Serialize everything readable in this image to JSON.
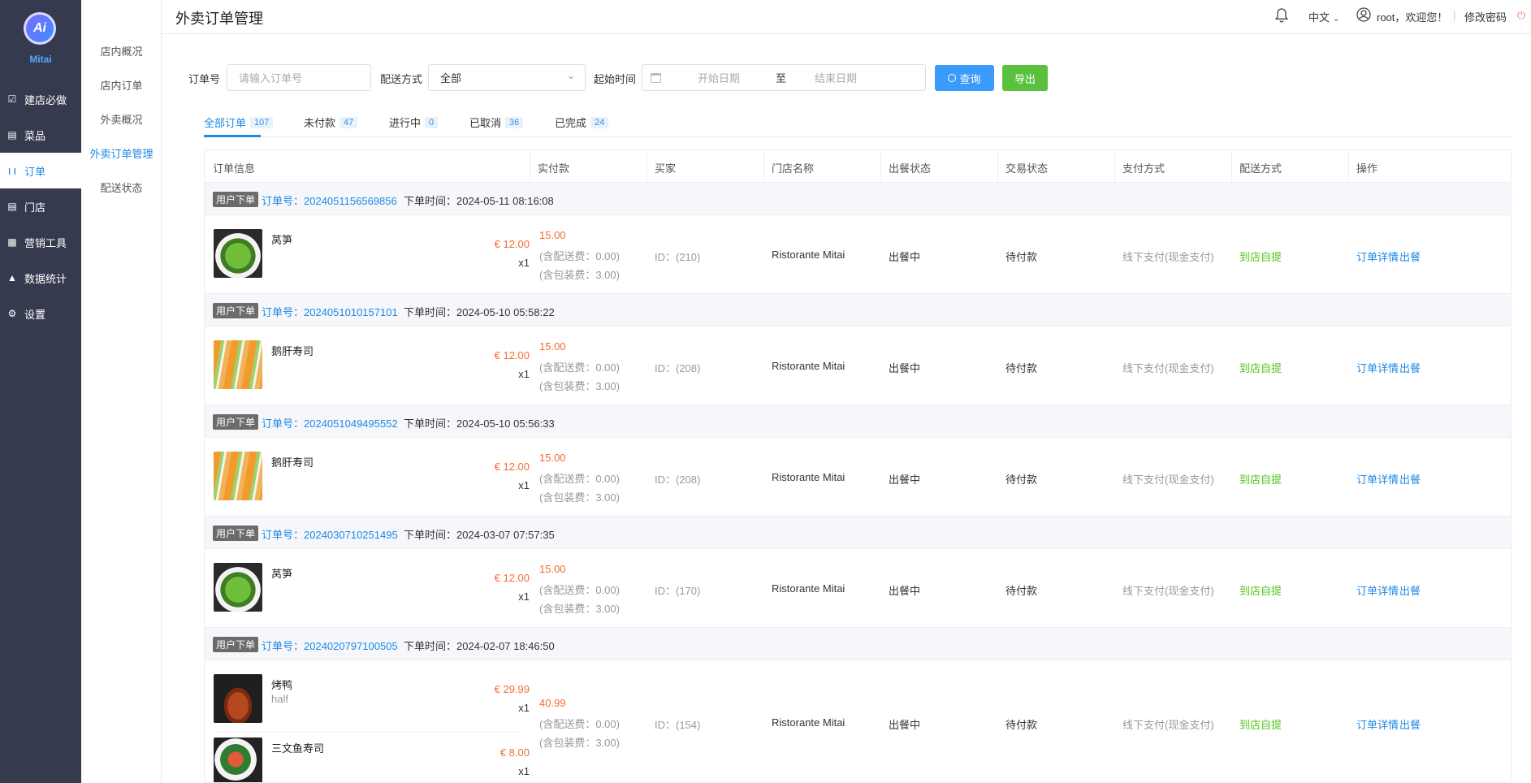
{
  "sidebar": {
    "brand": "Mitai",
    "items": [
      {
        "label": "建店必做",
        "icon": "checkbox-icon"
      },
      {
        "label": "菜品",
        "icon": "dish-icon"
      },
      {
        "label": "订单",
        "icon": "fork-knife-icon",
        "active": true
      },
      {
        "label": "门店",
        "icon": "store-icon"
      },
      {
        "label": "营销工具",
        "icon": "basket-icon"
      },
      {
        "label": "数据统计",
        "icon": "chart-icon"
      },
      {
        "label": "设置",
        "icon": "gear-icon"
      }
    ]
  },
  "submenu": {
    "items": [
      {
        "label": "店内概况"
      },
      {
        "label": "店内订单"
      },
      {
        "label": "外卖概况"
      },
      {
        "label": "外卖订单管理",
        "active": true
      },
      {
        "label": "配送状态"
      }
    ]
  },
  "topbar": {
    "title": "外卖订单管理",
    "language": "中文",
    "user": "root，欢迎您！",
    "change_password": "修改密码"
  },
  "filters": {
    "order_no_label": "订单号",
    "order_no_placeholder": "请输入订单号",
    "delivery_label": "配送方式",
    "delivery_value": "全部",
    "start_label": "起始时间",
    "start_placeholder": "开始日期",
    "range_sep": "至",
    "end_placeholder": "结束日期",
    "search_label": "查询",
    "export_label": "导出"
  },
  "tabs": [
    {
      "label": "全部订单",
      "count": "107",
      "active": true
    },
    {
      "label": "未付款",
      "count": "47"
    },
    {
      "label": "进行中",
      "count": "0"
    },
    {
      "label": "已取消",
      "count": "36"
    },
    {
      "label": "已完成",
      "count": "24"
    }
  ],
  "table": {
    "headers": [
      "订单信息",
      "实付款",
      "买家",
      "门店名称",
      "出餐状态",
      "交易状态",
      "支付方式",
      "配送方式",
      "操作"
    ],
    "orders": [
      {
        "tag": "用户下单",
        "order_no": "订单号：2024051156569856",
        "time": "下单时间：2024-05-11 08:16:08",
        "items": [
          {
            "name": "莴笋",
            "spec": "",
            "price": "€ 12.00",
            "qty": "x1",
            "img": "salad"
          }
        ],
        "paid": "15.00",
        "delivery_fee": "(含配送费：0.00)",
        "pack_fee": "(含包装费：3.00)",
        "buyer": "ID：(210)",
        "store": "Ristorante Mitai",
        "kitchen": "出餐中",
        "trade": "待付款",
        "payment": "线下支付(现金支付)",
        "delivery": "到店自提",
        "action_detail": "订单详情",
        "action_serve": "出餐"
      },
      {
        "tag": "用户下单",
        "order_no": "订单号：2024051010157101",
        "time": "下单时间：2024-05-10 05:58:22",
        "items": [
          {
            "name": "鹅肝寿司",
            "spec": "",
            "price": "€ 12.00",
            "qty": "x1",
            "img": "sushi"
          }
        ],
        "paid": "15.00",
        "delivery_fee": "(含配送费：0.00)",
        "pack_fee": "(含包装费：3.00)",
        "buyer": "ID：(208)",
        "store": "Ristorante Mitai",
        "kitchen": "出餐中",
        "trade": "待付款",
        "payment": "线下支付(现金支付)",
        "delivery": "到店自提",
        "action_detail": "订单详情",
        "action_serve": "出餐"
      },
      {
        "tag": "用户下单",
        "order_no": "订单号：2024051049495552",
        "time": "下单时间：2024-05-10 05:56:33",
        "items": [
          {
            "name": "鹅肝寿司",
            "spec": "",
            "price": "€ 12.00",
            "qty": "x1",
            "img": "sushi"
          }
        ],
        "paid": "15.00",
        "delivery_fee": "(含配送费：0.00)",
        "pack_fee": "(含包装费：3.00)",
        "buyer": "ID：(208)",
        "store": "Ristorante Mitai",
        "kitchen": "出餐中",
        "trade": "待付款",
        "payment": "线下支付(现金支付)",
        "delivery": "到店自提",
        "action_detail": "订单详情",
        "action_serve": "出餐"
      },
      {
        "tag": "用户下单",
        "order_no": "订单号：2024030710251495",
        "time": "下单时间：2024-03-07 07:57:35",
        "items": [
          {
            "name": "莴笋",
            "spec": "",
            "price": "€ 12.00",
            "qty": "x1",
            "img": "salad"
          }
        ],
        "paid": "15.00",
        "delivery_fee": "(含配送费：0.00)",
        "pack_fee": "(含包装费：3.00)",
        "buyer": "ID：(170)",
        "store": "Ristorante Mitai",
        "kitchen": "出餐中",
        "trade": "待付款",
        "payment": "线下支付(现金支付)",
        "delivery": "到店自提",
        "action_detail": "订单详情",
        "action_serve": "出餐"
      },
      {
        "tag": "用户下单",
        "order_no": "订单号：2024020797100505",
        "time": "下单时间：2024-02-07 18:46:50",
        "items": [
          {
            "name": "烤鸭",
            "spec": "half",
            "price": "€ 29.99",
            "qty": "x1",
            "img": "duck"
          },
          {
            "name": "三文鱼寿司",
            "spec": "",
            "price": "€ 8.00",
            "qty": "x1",
            "img": "salmon"
          }
        ],
        "paid": "40.99",
        "delivery_fee": "(含配送费：0.00)",
        "pack_fee": "(含包装费：3.00)",
        "buyer": "ID：(154)",
        "store": "Ristorante Mitai",
        "kitchen": "出餐中",
        "trade": "待付款",
        "payment": "线下支付(现金支付)",
        "delivery": "到店自提",
        "action_detail": "订单详情",
        "action_serve": "出餐"
      }
    ]
  },
  "colors": {
    "sidebar": "#363a4f",
    "accent": "#1e88e5",
    "price": "#f56c2d",
    "success": "#52c41a",
    "export": "#5ac13e",
    "search": "#3a9bfa"
  }
}
